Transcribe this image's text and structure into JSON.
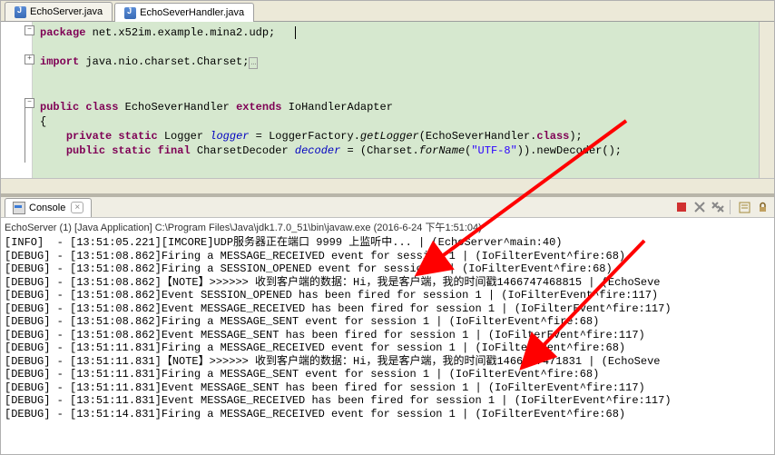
{
  "tabs": {
    "t0": {
      "label": "EchoServer.java"
    },
    "t1": {
      "label": "EchoSeverHandler.java"
    }
  },
  "code": {
    "package_kw": "package",
    "package_name": " net.x52im.example.mina2.udp;",
    "import_kw": "import",
    "import_name": " java.nio.charset.Charset;",
    "public_kw": "public",
    "class_kw": " class",
    "class_name": " EchoSeverHandler ",
    "extends_kw": "extends",
    "super_name": " IoHandlerAdapter",
    "brace_open": "{",
    "private_kw": "private",
    "static_kw": " static",
    "logger_type": " Logger ",
    "logger_name": "logger",
    "logger_rest1": " = LoggerFactory.",
    "getLogger": "getLogger",
    "logger_rest2": "(EchoSeverHandler.",
    "class_lit": "class",
    "logger_rest3": ");",
    "public2_kw": "public",
    "final_kw": " final",
    "decoder_type": " CharsetDecoder ",
    "decoder_name": "decoder",
    "decoder_rest1": " = (Charset.",
    "forName": "forName",
    "decoder_rest2": "(",
    "utf8": "\"UTF-8\"",
    "decoder_rest3": ")).newDecoder();"
  },
  "console": {
    "label": "Console",
    "desc": "EchoServer (1) [Java Application] C:\\Program Files\\Java\\jdk1.7.0_51\\bin\\javaw.exe (2016-6-24 下午1:51:04)",
    "lines": [
      "[INFO]  - [13:51:05.221][IMCORE]UDP服务器正在端口 9999 上监听中... | (EchoServer^main:40)",
      "[DEBUG] - [13:51:08.862]Firing a MESSAGE_RECEIVED event for session 1 | (IoFilterEvent^fire:68)",
      "[DEBUG] - [13:51:08.862]Firing a SESSION_OPENED event for session 1 | (IoFilterEvent^fire:68)",
      "[DEBUG] - [13:51:08.862]【NOTE】>>>>>> 收到客户端的数据：Hi，我是客户端，我的时间戳1466747468815 | (EchoSeve",
      "[DEBUG] - [13:51:08.862]Event SESSION_OPENED has been fired for session 1 | (IoFilterEvent^fire:117)",
      "[DEBUG] - [13:51:08.862]Event MESSAGE_RECEIVED has been fired for session 1 | (IoFilterEvent^fire:117)",
      "[DEBUG] - [13:51:08.862]Firing a MESSAGE_SENT event for session 1 | (IoFilterEvent^fire:68)",
      "[DEBUG] - [13:51:08.862]Event MESSAGE_SENT has been fired for session 1 | (IoFilterEvent^fire:117)",
      "[DEBUG] - [13:51:11.831]Firing a MESSAGE_RECEIVED event for session 1 | (IoFilterEvent^fire:68)",
      "[DEBUG] - [13:51:11.831]【NOTE】>>>>>> 收到客户端的数据：Hi，我是客户端，我的时间戳1466747471831 | (EchoSeve",
      "[DEBUG] - [13:51:11.831]Firing a MESSAGE_SENT event for session 1 | (IoFilterEvent^fire:68)",
      "[DEBUG] - [13:51:11.831]Event MESSAGE_SENT has been fired for session 1 | (IoFilterEvent^fire:117)",
      "[DEBUG] - [13:51:11.831]Event MESSAGE_RECEIVED has been fired for session 1 | (IoFilterEvent^fire:117)",
      "[DEBUG] - [13:51:14.831]Firing a MESSAGE_RECEIVED event for session 1 | (IoFilterEvent^fire:68)"
    ]
  }
}
